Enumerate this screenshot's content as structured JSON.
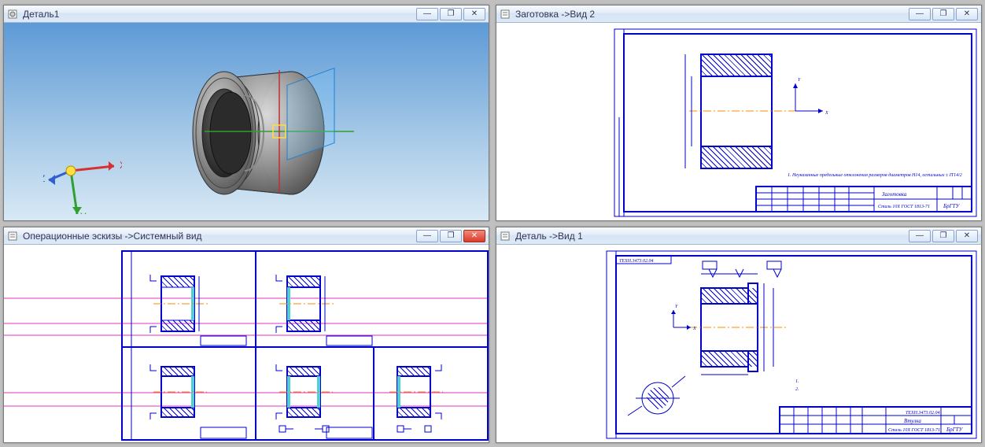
{
  "panes": {
    "top_left": {
      "title": "Деталь1",
      "axis": {
        "x": "X",
        "y": "Y",
        "z": "Z"
      }
    },
    "top_right": {
      "title": "Заготовка  ->Вид 2",
      "stamp_title": "Заготовка",
      "stamp_mat": "Сталь 10Х ГОСТ 1813-71",
      "stamp_org": "БрГТУ",
      "note": "1. Неуказанные предельные отклонения размеров диаметров H14, остальных ± IT14/2",
      "axis_x": "X",
      "axis_y": "Y"
    },
    "bottom_left": {
      "title": "Операционные эскизы ->Системный вид"
    },
    "bottom_right": {
      "title": "Деталь ->Вид 1",
      "stamp_title": "Втулка",
      "stamp_mat": "Сталь 10Х ГОСТ 1813-71",
      "stamp_org": "БрГТУ",
      "corner": "ТЕХН.3473.02.04",
      "axis_x": "X",
      "axis_y": "Y"
    }
  },
  "winbtn_min": "—",
  "winbtn_max": "❐",
  "winbtn_close": "✕"
}
